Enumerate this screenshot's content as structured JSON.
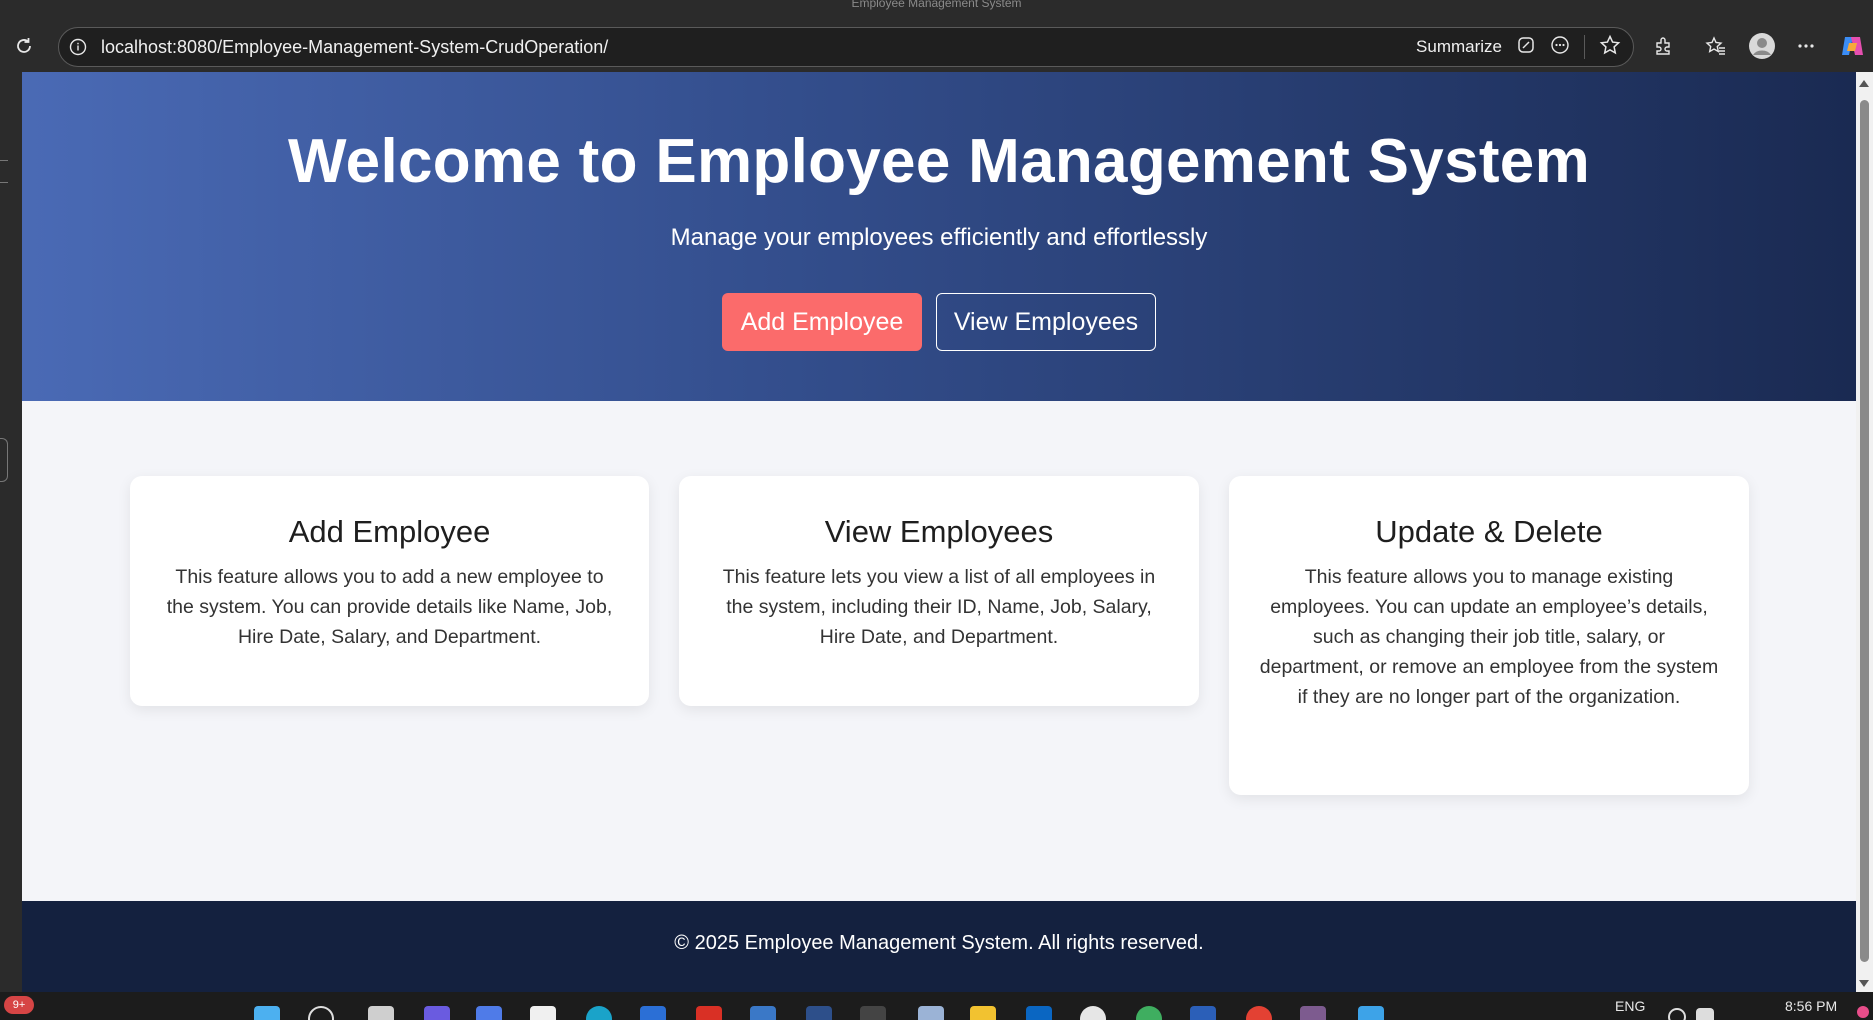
{
  "browser": {
    "window_title": "Employee Management System",
    "url": "localhost:8080/Employee-Management-System-CrudOperation/",
    "summarize_label": "Summarize"
  },
  "hero": {
    "title": "Welcome to Employee Management System",
    "subtitle": "Manage your employees efficiently and effortlessly",
    "add_button": "Add Employee",
    "view_button": "View Employees"
  },
  "features": [
    {
      "title": "Add Employee",
      "description": "This feature allows you to add a new employee to the system. You can provide details like Name, Job, Hire Date, Salary, and Department."
    },
    {
      "title": "View Employees",
      "description": "This feature lets you view a list of all employees in the system, including their ID, Name, Job, Salary, Hire Date, and Department."
    },
    {
      "title": "Update & Delete",
      "description": "This feature allows you to manage existing employees. You can update an employee’s details, such as changing their job title, salary, or department, or remove an employee from the system if they are no longer part of the organization."
    }
  ],
  "footer": {
    "text": "© 2025 Employee Management System. All rights reserved."
  },
  "taskbar": {
    "notification_badge": "9+",
    "language": "ENG",
    "time": "8:56 PM"
  },
  "colors": {
    "hero_gradient_start": "#4a6ab5",
    "hero_gradient_end": "#1a2a52",
    "add_button": "#fb6b6b",
    "footer_bg": "#14213f",
    "page_bg": "#f4f5f9"
  }
}
